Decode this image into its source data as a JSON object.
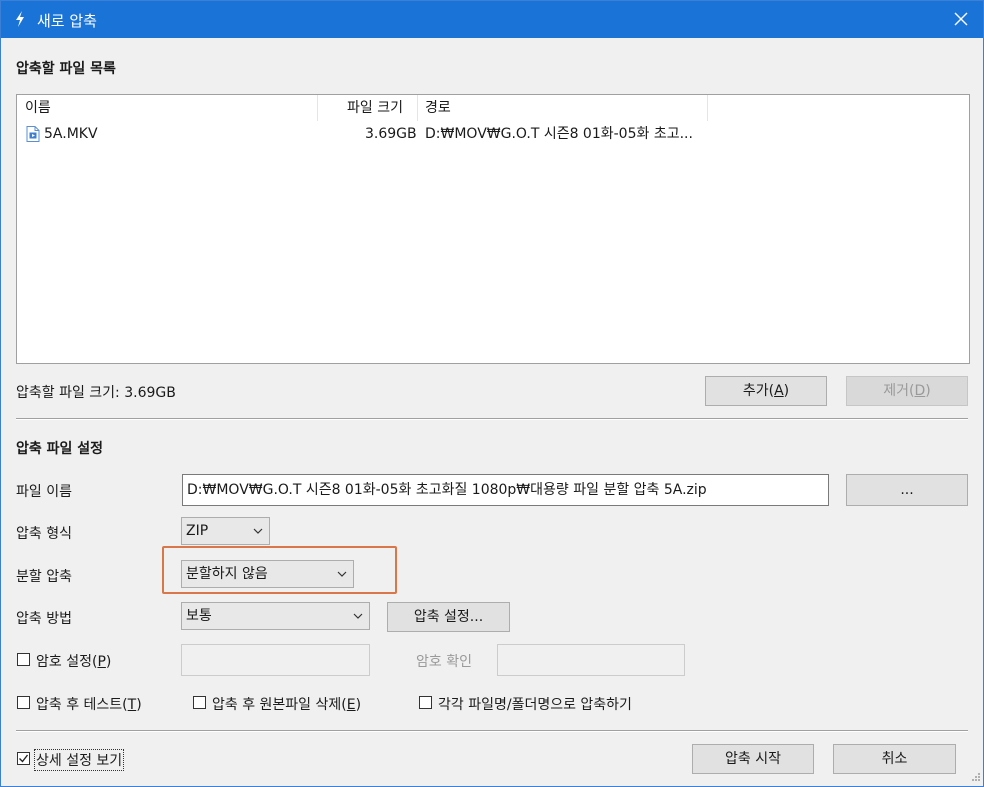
{
  "window": {
    "title": "새로 압축",
    "close_label": "✕"
  },
  "file_list": {
    "section_title": "압축할 파일 목록",
    "columns": [
      "이름",
      "파일 크기",
      "경로"
    ],
    "rows": [
      {
        "name": "5A.MKV",
        "size": "3.69GB",
        "path": "D:₩MOV₩G.O.T 시즌8 01화-05화 초고..."
      }
    ],
    "total_size_label": "압축할 파일 크기: 3.69GB",
    "add_button": {
      "text": "추가(",
      "key": "A",
      "end": ")"
    },
    "remove_button": {
      "text": "제거(",
      "key": "D",
      "end": ")"
    }
  },
  "settings": {
    "section_title": "압축 파일 설정",
    "filename_label": "파일 이름",
    "filename_value": "D:₩MOV₩G.O.T 시즌8 01화-05화 초고화질 1080p₩대용량 파일 분할 압축 5A.zip",
    "browse_button": "...",
    "format_label": "압축 형식",
    "format_value": "ZIP",
    "split_label": "분할 압축",
    "split_value": "분할하지 않음",
    "method_label": "압축 방법",
    "method_value": "보통",
    "method_settings_button": "압축 설정...",
    "password_label": "암호 설정(",
    "password_key": "P",
    "password_end": ")",
    "password_value": "",
    "confirm_label": "암호 확인",
    "confirm_value": "",
    "test_label": "압축 후 테스트(",
    "test_key": "T",
    "test_end": ")",
    "delete_label": "압축 후 원본파일 삭제(",
    "delete_key": "E",
    "delete_end": ")",
    "each_label": "각각 파일명/폴더명으로 압축하기"
  },
  "footer": {
    "details_label": "상세 설정 보기",
    "details_checked": true,
    "start_button": "압축 시작",
    "cancel_button": "취소"
  }
}
